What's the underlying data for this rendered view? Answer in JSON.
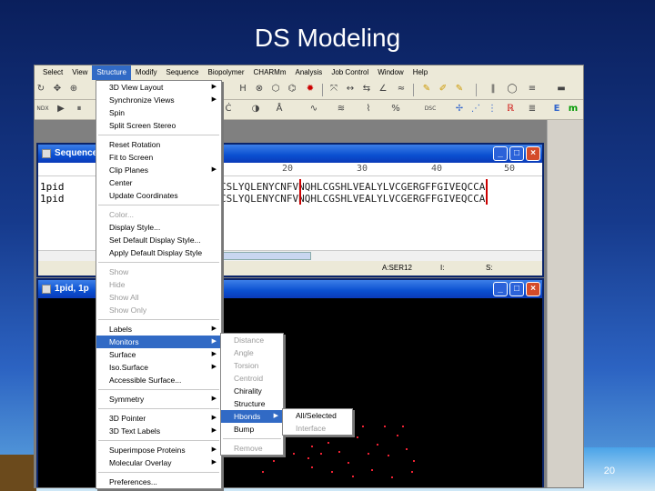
{
  "slide": {
    "title": "DS Modeling",
    "number": "20"
  },
  "menubar": [
    "Select",
    "View",
    "Structure",
    "Modify",
    "Sequence",
    "Biopolymer",
    "CHARMm",
    "Analysis",
    "Job Control",
    "Window",
    "Help"
  ],
  "toolbar": {
    "letters": {
      "h": "H",
      "e": "E",
      "m": "m"
    }
  },
  "sequence_window": {
    "title": "Sequence",
    "ruler": [
      "20",
      "30",
      "40",
      "50"
    ],
    "names": [
      "1pid",
      "1pid"
    ],
    "rows": [
      "CSLYQLENYCNFVNQHLCGSHLVEALYLVCGERGFFGIVEQCCA",
      "CSLYQLENYCNFVNQHLCGSHLVEALYLVCGERGFFGIVEQCCA"
    ],
    "status": {
      "residue": "A:SER12",
      "i": "I:",
      "s": "S:"
    }
  },
  "molecule_window": {
    "title": "1pid, 1p"
  },
  "structure_menu": [
    [
      {
        "label": "3D View Layout",
        "sub": true
      },
      {
        "label": "Synchronize Views",
        "sub": true
      },
      {
        "label": "Spin"
      },
      {
        "label": "Split Screen Stereo"
      }
    ],
    [
      {
        "label": "Reset Rotation"
      },
      {
        "label": "Fit to Screen"
      },
      {
        "label": "Clip Planes",
        "sub": true
      },
      {
        "label": "Center"
      },
      {
        "label": "Update Coordinates"
      }
    ],
    [
      {
        "label": "Color...",
        "disabled": true
      },
      {
        "label": "Display Style..."
      },
      {
        "label": "Set Default Display Style..."
      },
      {
        "label": "Apply Default Display Style"
      }
    ],
    [
      {
        "label": "Show",
        "disabled": true
      },
      {
        "label": "Hide",
        "disabled": true
      },
      {
        "label": "Show All",
        "disabled": true
      },
      {
        "label": "Show Only",
        "disabled": true
      }
    ],
    [
      {
        "label": "Labels",
        "sub": true
      },
      {
        "label": "Monitors",
        "sub": true,
        "highlight": true
      },
      {
        "label": "Surface",
        "sub": true
      },
      {
        "label": "Iso.Surface",
        "sub": true
      },
      {
        "label": "Accessible Surface..."
      }
    ],
    [
      {
        "label": "Symmetry",
        "sub": true
      }
    ],
    [
      {
        "label": "3D Pointer",
        "sub": true
      },
      {
        "label": "3D Text Labels",
        "sub": true
      }
    ],
    [
      {
        "label": "Superimpose Proteins",
        "sub": true
      },
      {
        "label": "Molecular Overlay",
        "sub": true
      }
    ],
    [
      {
        "label": "Preferences..."
      }
    ]
  ],
  "monitors_menu": [
    [
      {
        "label": "Distance",
        "disabled": true
      },
      {
        "label": "Angle",
        "disabled": true
      },
      {
        "label": "Torsion",
        "disabled": true
      },
      {
        "label": "Centroid",
        "disabled": true
      },
      {
        "label": "Chirality"
      },
      {
        "label": "Structure"
      },
      {
        "label": "Hbonds",
        "sub": true,
        "highlight": true
      },
      {
        "label": "Bump"
      }
    ],
    [
      {
        "label": "Remove",
        "disabled": true
      }
    ]
  ],
  "hbonds_menu": [
    [
      {
        "label": "All/Selected"
      },
      {
        "label": "Interface",
        "disabled": true
      }
    ]
  ]
}
